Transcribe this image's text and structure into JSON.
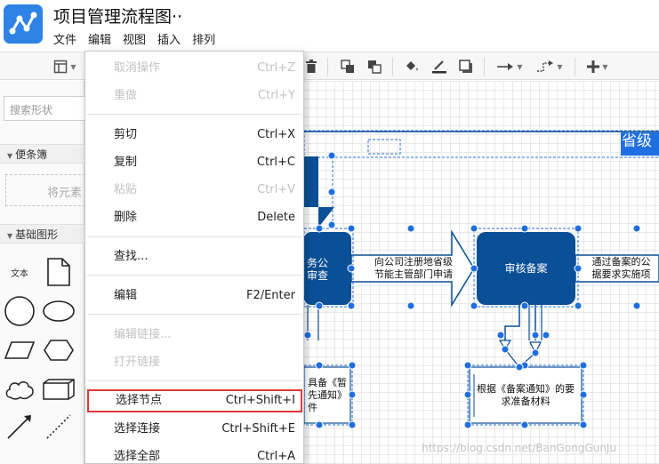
{
  "app": {
    "doc_title": "项目管理流程图··",
    "menus": [
      "文件",
      "编辑",
      "视图",
      "插入",
      "排列"
    ]
  },
  "sidebar": {
    "search_placeholder": "搜索形状",
    "scratchpad_title": "便条簿",
    "scratchpad_hint": "将元素",
    "basic_shapes_title": "基础图形",
    "text_shape_label": "文本"
  },
  "canvas": {
    "header_text": "省级",
    "node_left_label": "务公\n审查",
    "arrow1_label": "向公司注册地省级\n节能主管部门申请",
    "node_review_label": "审核备案",
    "arrow2_label": "通过备案的公\n据要求实施项",
    "note1_label": "具备《暂\n先通知》\n件",
    "note2_label": "根据《备案通知》的要\n求准备材料"
  },
  "watermark": "https://blog.csdn.net/BanGongGunJu",
  "edit_menu": {
    "groups": [
      [
        {
          "label": "取消操作",
          "shortcut": "Ctrl+Z",
          "enabled": false
        },
        {
          "label": "重做",
          "shortcut": "Ctrl+Y",
          "enabled": false
        }
      ],
      [
        {
          "label": "剪切",
          "shortcut": "Ctrl+X",
          "enabled": true
        },
        {
          "label": "复制",
          "shortcut": "Ctrl+C",
          "enabled": true
        },
        {
          "label": "粘贴",
          "shortcut": "Ctrl+V",
          "enabled": false
        },
        {
          "label": "删除",
          "shortcut": "Delete",
          "enabled": true
        }
      ],
      [
        {
          "label": "查找...",
          "shortcut": "",
          "enabled": true
        }
      ],
      [
        {
          "label": "编辑",
          "shortcut": "F2/Enter",
          "enabled": true
        }
      ],
      [
        {
          "label": "编辑链接...",
          "shortcut": "",
          "enabled": false
        },
        {
          "label": "打开链接",
          "shortcut": "",
          "enabled": false
        }
      ],
      [
        {
          "label": "选择节点",
          "shortcut": "Ctrl+Shift+I",
          "enabled": true,
          "highlighted": true
        },
        {
          "label": "选择连接",
          "shortcut": "Ctrl+Shift+E",
          "enabled": true
        },
        {
          "label": "选择全部",
          "shortcut": "Ctrl+A",
          "enabled": true
        }
      ]
    ]
  },
  "colors": {
    "brand": "#2f83e6",
    "node_fill": "#0b4f96",
    "selection": "#1f6fe0",
    "highlight_border": "#e0383b"
  }
}
